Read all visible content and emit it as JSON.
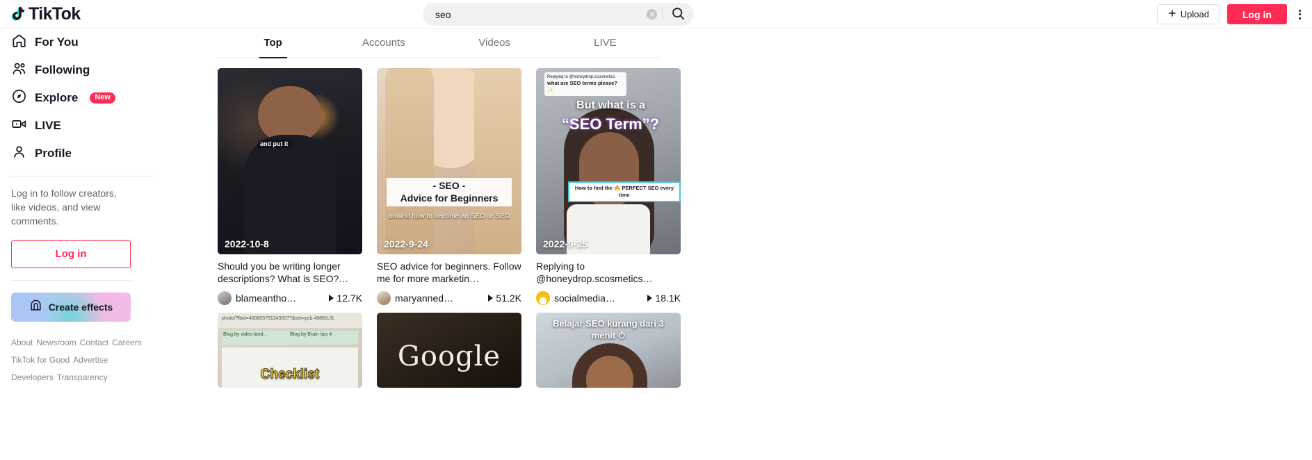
{
  "header": {
    "logo_text": "TikTok",
    "search": {
      "value": "seo",
      "placeholder": "Search"
    },
    "upload_label": "Upload",
    "login_label": "Log in"
  },
  "sidebar": {
    "items": [
      {
        "label": "For You",
        "icon": "home-icon",
        "badge": ""
      },
      {
        "label": "Following",
        "icon": "people-icon",
        "badge": ""
      },
      {
        "label": "Explore",
        "icon": "compass-icon",
        "badge": "New"
      },
      {
        "label": "LIVE",
        "icon": "live-video-icon",
        "badge": ""
      },
      {
        "label": "Profile",
        "icon": "person-icon",
        "badge": ""
      }
    ],
    "login_prompt": "Log in to follow creators, like videos, and view comments.",
    "login_button": "Log in",
    "create_effects": "Create effects",
    "footer": [
      [
        "About",
        "Newsroom",
        "Contact",
        "Careers"
      ],
      [
        "TikTok for Good",
        "Advertise"
      ],
      [
        "Developers",
        "Transparency"
      ]
    ]
  },
  "main": {
    "tabs": [
      {
        "label": "Top",
        "active": true
      },
      {
        "label": "Accounts",
        "active": false
      },
      {
        "label": "Videos",
        "active": false
      },
      {
        "label": "LIVE",
        "active": false
      }
    ],
    "cards": [
      {
        "date": "2022-10-8",
        "caption": "Should you be writing longer descriptions? What is SEO?…",
        "author": "blameantho…",
        "views": "12.7K",
        "overlay_shirt": "and put it"
      },
      {
        "date": "2022-9-24",
        "caption": "SEO advice for beginners. Follow me for more marketin…",
        "author": "maryanned…",
        "views": "51.2K",
        "overlay_line1": "- SEO -",
        "overlay_line2": "Advice for Beginners",
        "overlay_sub": "around how to become an SEO or SEO"
      },
      {
        "date": "2022-9-25",
        "caption": "Replying to ",
        "caption_mention": "@honeydrop.scosmetics…",
        "author": "socialmedia…",
        "views": "18.1K",
        "overlay_reply_head": "Replying to @honeydrop.scosmetics",
        "overlay_reply_q": "what are SEO terms please?✨",
        "overlay_line1": "But what is a",
        "overlay_line2": "“SEO Term”?",
        "overlay_badge": "How to find the 🔥 PERFECT SEO every time"
      },
      {
        "date": "",
        "caption": "",
        "author": "",
        "views": "",
        "overlay_line1": "Checklist"
      },
      {
        "date": "",
        "caption": "",
        "author": "",
        "views": "",
        "overlay_line1": "Google"
      },
      {
        "date": "",
        "caption": "",
        "author": "",
        "views": "",
        "overlay_line1": "Belajar SEO kurang dari 3 menit ⏱"
      }
    ]
  }
}
